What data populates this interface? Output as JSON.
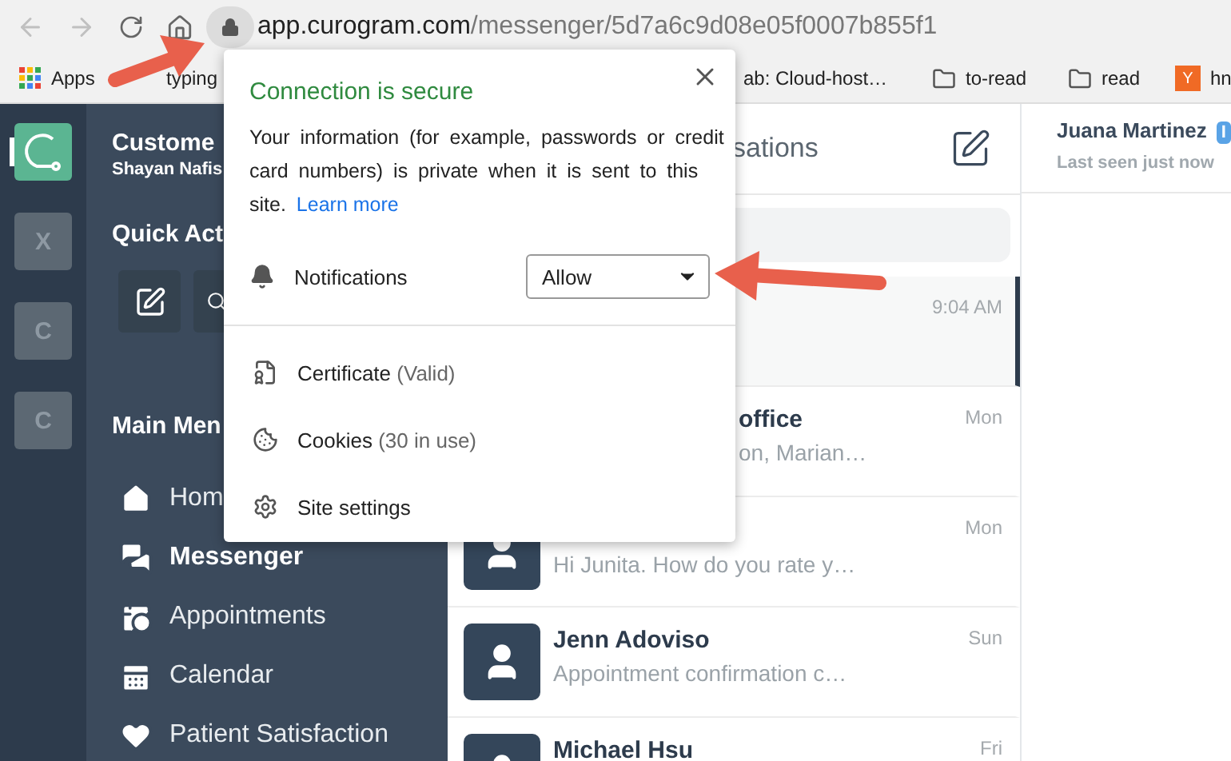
{
  "browser": {
    "url_host": "app.curogram.com",
    "url_path": "/messenger/5d7a6c9d08e05f0007b855f1"
  },
  "bookmarks": [
    {
      "kind": "apps",
      "label": "Apps"
    },
    {
      "kind": "page",
      "label": "typing"
    },
    {
      "kind": "page",
      "label": "ab: Cloud-host…"
    },
    {
      "kind": "folder",
      "label": "to-read"
    },
    {
      "kind": "folder",
      "label": "read"
    },
    {
      "kind": "site",
      "label": "hn",
      "badge": "Y"
    }
  ],
  "rail": [
    {
      "kind": "logo",
      "selected": true
    },
    {
      "kind": "tile",
      "label": "X",
      "selected": false
    },
    {
      "kind": "tile",
      "label": "C",
      "selected": false
    },
    {
      "kind": "tile",
      "label": "C",
      "selected": false
    }
  ],
  "sidebar": {
    "title": "Custome",
    "subtitle": "Shayan Nafis",
    "quick_title": "Quick Act",
    "menu_title": "Main Men",
    "items": [
      {
        "kind": "home",
        "label": "Hom",
        "selected": false
      },
      {
        "kind": "messenger",
        "label": "Messenger",
        "selected": true
      },
      {
        "kind": "appointments",
        "label": "Appointments",
        "selected": false
      },
      {
        "kind": "calendar",
        "label": "Calendar",
        "selected": false
      },
      {
        "kind": "satisfaction",
        "label": "Patient Satisfaction",
        "selected": false
      }
    ]
  },
  "conversations": {
    "title": "sations",
    "rows": [
      {
        "kind": "covered",
        "time": "9:04 AM",
        "selected": true
      },
      {
        "kind": "covered",
        "name": "office",
        "preview": "on, Marian…",
        "time": "Mon",
        "selected": false
      },
      {
        "kind": "avatar",
        "preview": "Hi Junita. How do you rate y…",
        "time": "Mon",
        "selected": false
      },
      {
        "kind": "full",
        "name": "Jenn Adoviso",
        "preview": "Appointment confirmation c…",
        "time": "Sun",
        "selected": false
      },
      {
        "kind": "full",
        "name": "Michael Hsu",
        "time": "Fri",
        "selected": false
      }
    ]
  },
  "chat": {
    "name": "Juana Martinez",
    "badge": "I",
    "status": "Last seen just now"
  },
  "popup": {
    "title": "Connection is secure",
    "description": "Your information (for example, passwords or credit card numbers) is private when it is sent to this site.",
    "link": "Learn more",
    "permission": {
      "label": "Notifications",
      "value": "Allow"
    },
    "rows": [
      {
        "kind": "certificate",
        "label": "Certificate",
        "detail": "(Valid)"
      },
      {
        "kind": "cookies",
        "label": "Cookies",
        "detail": "(30 in use)"
      },
      {
        "kind": "settings",
        "label": "Site settings"
      }
    ]
  }
}
